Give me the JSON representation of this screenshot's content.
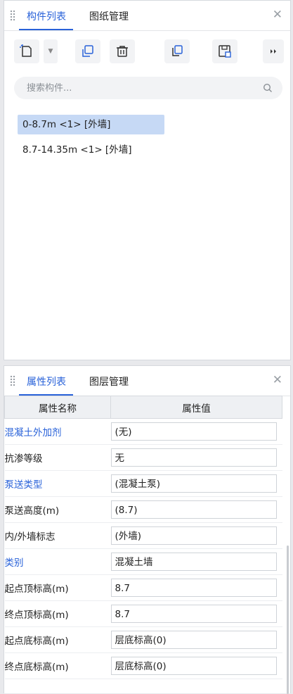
{
  "component_panel": {
    "tabs": [
      {
        "label": "构件列表",
        "active": true
      },
      {
        "label": "图纸管理",
        "active": false
      }
    ],
    "toolbar": [
      {
        "icon": "new-component-icon"
      },
      {
        "icon": "copy-icon"
      },
      {
        "icon": "delete-icon"
      },
      {
        "icon": "layer-copy-icon"
      },
      {
        "icon": "save-template-icon"
      },
      {
        "icon": "more-icon"
      }
    ],
    "search": {
      "placeholder": "搜索构件...",
      "value": ""
    },
    "items": [
      {
        "label": "0-8.7m <1> [外墙]",
        "selected": true
      },
      {
        "label": "8.7-14.35m <1> [外墙]",
        "selected": false
      }
    ]
  },
  "property_panel": {
    "tabs": [
      {
        "label": "属性列表",
        "active": true
      },
      {
        "label": "图层管理",
        "active": false
      }
    ],
    "headers": {
      "name": "属性名称",
      "value": "属性值"
    },
    "rows": [
      {
        "name": "混凝土外加剂",
        "value": "(无)",
        "link": true
      },
      {
        "name": "抗渗等级",
        "value": "无",
        "link": false
      },
      {
        "name": "泵送类型",
        "value": "(混凝土泵)",
        "link": true
      },
      {
        "name": "泵送高度(m)",
        "value": "(8.7)",
        "link": false
      },
      {
        "name": "内/外墙标志",
        "value": "(外墙)",
        "link": false
      },
      {
        "name": "类别",
        "value": "混凝土墙",
        "link": true
      },
      {
        "name": "起点顶标高(m)",
        "value": "8.7",
        "link": false
      },
      {
        "name": "终点顶标高(m)",
        "value": "8.7",
        "link": false
      },
      {
        "name": "起点底标高(m)",
        "value": "层底标高(0)",
        "link": false
      },
      {
        "name": "终点底标高(m)",
        "value": "层底标高(0)",
        "link": false
      }
    ]
  },
  "colors": {
    "accent": "#2962d9",
    "selected_bg": "#c6d9f5"
  }
}
